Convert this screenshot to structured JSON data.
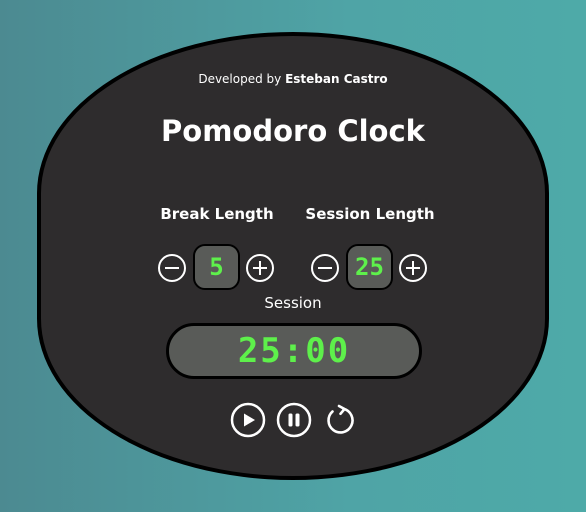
{
  "credit": {
    "prefix": "Developed by",
    "author": "Esteban Castro"
  },
  "title": "Pomodoro Clock",
  "break": {
    "label": "Break Length",
    "value": "5"
  },
  "session": {
    "label": "Session Length",
    "value": "25"
  },
  "timer": {
    "mode": "Session",
    "display": "25:00"
  },
  "icons": {
    "decrement": "minus-circle-icon",
    "increment": "plus-circle-icon",
    "play": "play-circle-icon",
    "pause": "pause-circle-icon",
    "reset": "refresh-icon"
  },
  "colors": {
    "background_start": "#4c8a91",
    "background_end": "#4eaaa8",
    "panel": "#2e2c2d",
    "display_bg": "#595b58",
    "digits": "#5ef04b",
    "text": "#ffffff"
  }
}
